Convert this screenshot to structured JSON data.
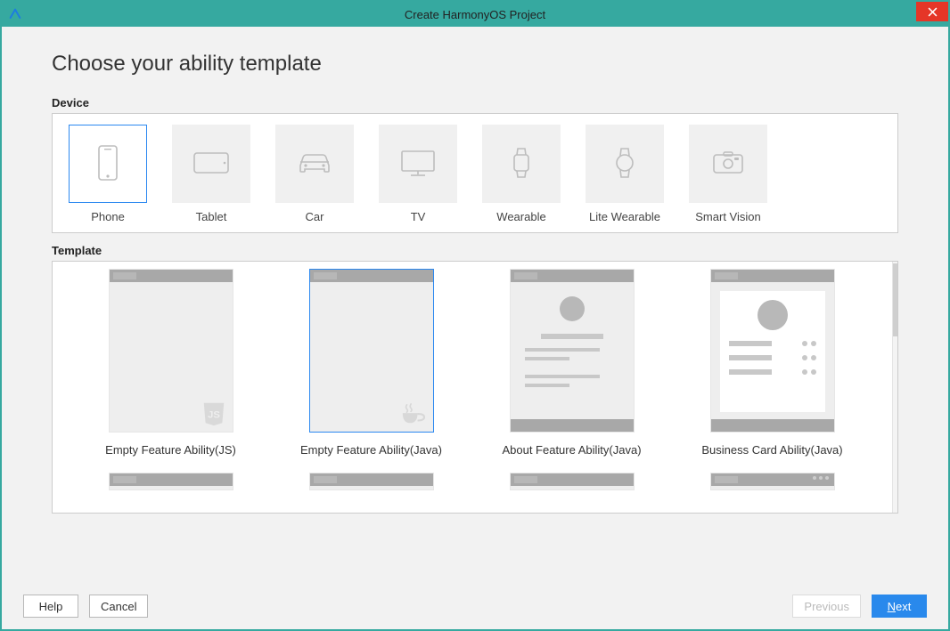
{
  "window": {
    "title": "Create HarmonyOS Project"
  },
  "page": {
    "heading": "Choose your ability template"
  },
  "device": {
    "label": "Device",
    "selectedIndex": 0,
    "items": [
      {
        "id": "phone",
        "label": "Phone",
        "icon": "phone-icon"
      },
      {
        "id": "tablet",
        "label": "Tablet",
        "icon": "tablet-icon"
      },
      {
        "id": "car",
        "label": "Car",
        "icon": "car-icon"
      },
      {
        "id": "tv",
        "label": "TV",
        "icon": "tv-icon"
      },
      {
        "id": "wearable",
        "label": "Wearable",
        "icon": "wearable-icon"
      },
      {
        "id": "lite-wearable",
        "label": "Lite Wearable",
        "icon": "lite-wearable-icon"
      },
      {
        "id": "smart-vision",
        "label": "Smart Vision",
        "icon": "smart-vision-icon"
      }
    ]
  },
  "template": {
    "label": "Template",
    "selectedIndex": 1,
    "items": [
      {
        "id": "empty-js",
        "label": "Empty Feature Ability(JS)"
      },
      {
        "id": "empty-java",
        "label": "Empty Feature Ability(Java)"
      },
      {
        "id": "about-java",
        "label": "About Feature Ability(Java)"
      },
      {
        "id": "business-card-java",
        "label": "Business Card Ability(Java)"
      }
    ]
  },
  "footer": {
    "help": "Help",
    "cancel": "Cancel",
    "previous": "Previous",
    "next_mnemonic": "N",
    "next_rest": "ext"
  }
}
